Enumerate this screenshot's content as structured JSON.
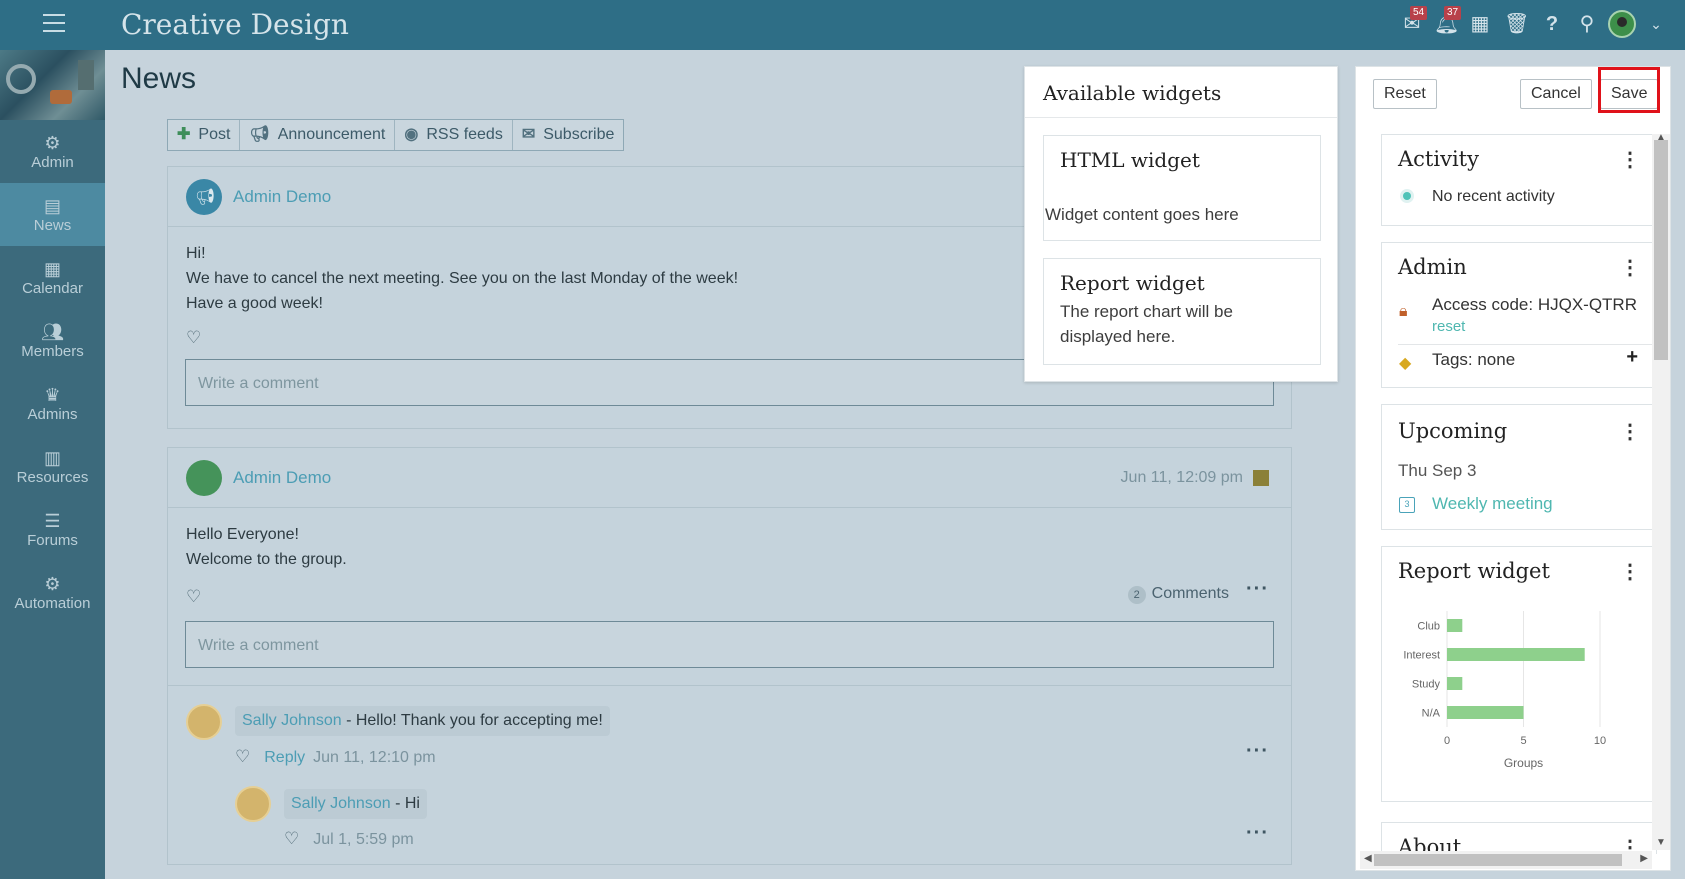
{
  "app": {
    "title": "Creative Design"
  },
  "topbar": {
    "inbox_badge": "54",
    "notifications_badge": "37"
  },
  "sidebar": {
    "items": [
      {
        "label": "Admin",
        "icon": "gear-icon"
      },
      {
        "label": "News",
        "icon": "news-icon"
      },
      {
        "label": "Calendar",
        "icon": "calendar-icon"
      },
      {
        "label": "Members",
        "icon": "members-icon"
      },
      {
        "label": "Admins",
        "icon": "crown-icon"
      },
      {
        "label": "Resources",
        "icon": "resources-icon"
      },
      {
        "label": "Forums",
        "icon": "forums-icon"
      },
      {
        "label": "Automation",
        "icon": "automation-icon"
      }
    ],
    "active": "News"
  },
  "page": {
    "title": "News"
  },
  "actions": {
    "post": "Post",
    "announcement": "Announcement",
    "rss": "RSS feeds",
    "subscribe": "Subscribe"
  },
  "posts": [
    {
      "author": "Admin Demo",
      "lines": [
        "Hi!",
        "We have to cancel the next meeting. See you on the last Monday of the week!",
        "Have a good week!"
      ],
      "comment_placeholder": "Write a comment"
    },
    {
      "author": "Admin Demo",
      "date": "Jun 11, 12:09 pm",
      "lines": [
        "Hello Everyone!",
        "Welcome to the group."
      ],
      "comment_count": "2",
      "comments_label": "Comments",
      "comment_placeholder": "Write a comment",
      "replies": [
        {
          "name": "Sally Johnson",
          "text": " - Hello! Thank you for accepting me!",
          "reply_label": "Reply",
          "date": "Jun 11, 12:10 pm"
        },
        {
          "name": "Sally Johnson",
          "text": " - Hi",
          "date": "Jul 1, 5:59 pm"
        }
      ]
    }
  ],
  "available_widgets": {
    "title": "Available widgets",
    "cards": [
      {
        "title": "HTML widget",
        "body": "Widget content goes here"
      },
      {
        "title": "Report widget",
        "body_line1": "The report chart will be",
        "body_line2": "displayed here."
      }
    ]
  },
  "layout_controls": {
    "reset": "Reset",
    "cancel": "Cancel",
    "save": "Save"
  },
  "widgets": {
    "activity": {
      "title": "Activity",
      "text": "No recent activity"
    },
    "admin": {
      "title": "Admin",
      "access_code": "Access code: HJQX-QTRR",
      "reset": "reset",
      "tags": "Tags: none"
    },
    "upcoming": {
      "title": "Upcoming",
      "date": "Thu Sep 3",
      "event": "Weekly meeting",
      "event_day": "3"
    },
    "report": {
      "title": "Report widget"
    },
    "about": {
      "title": "About"
    }
  },
  "chart_data": {
    "type": "bar",
    "orientation": "horizontal",
    "categories": [
      "Club",
      "Interest",
      "Study",
      "N/A"
    ],
    "values": [
      1,
      9,
      1,
      5
    ],
    "xlabel": "Groups",
    "xlim": [
      0,
      10
    ],
    "xticks": [
      "0",
      "5",
      "10"
    ],
    "bar_color": "#8ed08c",
    "grid": true
  },
  "colors": {
    "accent": "#2e6e86",
    "link": "#4c9db4",
    "save_highlight": "#e0121a"
  }
}
